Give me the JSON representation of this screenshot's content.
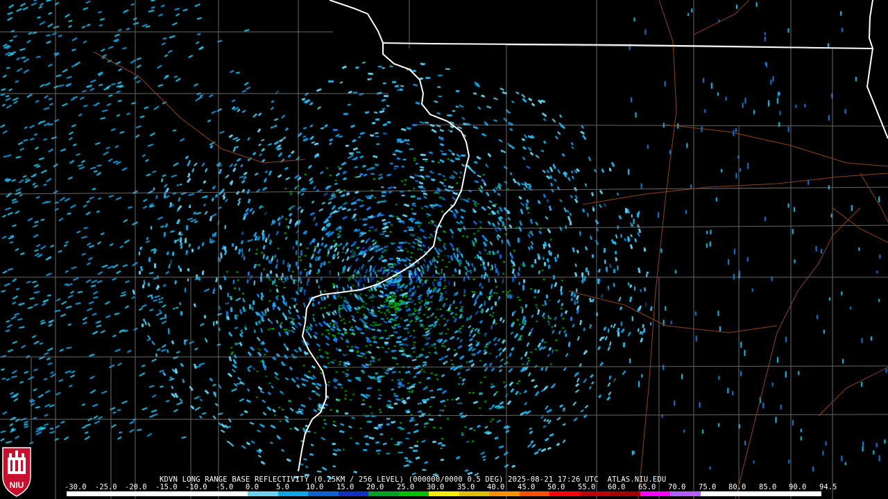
{
  "product_caption": "KDVN LONG RANGE BASE REFLECTIVITY (0.25KM / 256 LEVEL) (000000/0000 0.5 DEG) 2025-08-21 17:26 UTC  ATLAS.NIU.EDU",
  "logo_text": "NIU",
  "colors": {
    "background": "#000000",
    "county_lines": "#8a8a8a",
    "state_lines": "#ffffff",
    "highways": "#8b4513",
    "logo_red": "#c8102e"
  },
  "scale": {
    "labels": [
      "-30.0",
      "-25.0",
      "-20.0",
      "-15.0",
      "-10.0",
      "-5.0",
      "0.0",
      "5.0",
      "10.0",
      "15.0",
      "20.0",
      "25.0",
      "30.0",
      "35.0",
      "40.0",
      "45.0",
      "50.0",
      "55.0",
      "60.0",
      "65.0",
      "70.0",
      "75.0",
      "80.0",
      "85.0",
      "90.0",
      "94.5"
    ],
    "colors": [
      "#ffffff",
      "#ffffff",
      "#ffffff",
      "#ffffff",
      "#ffffff",
      "#ffffff",
      "#6ad4f0",
      "#12a4e8",
      "#0a66d0",
      "#1030c0",
      "#00a020",
      "#00c000",
      "#f0f000",
      "#e0c000",
      "#ff9000",
      "#ff5000",
      "#ff0000",
      "#c00000",
      "#a00000",
      "#ff00ff",
      "#b060ff",
      "#ffffff",
      "#ffffff",
      "#ffffff",
      "#ffffff"
    ]
  }
}
